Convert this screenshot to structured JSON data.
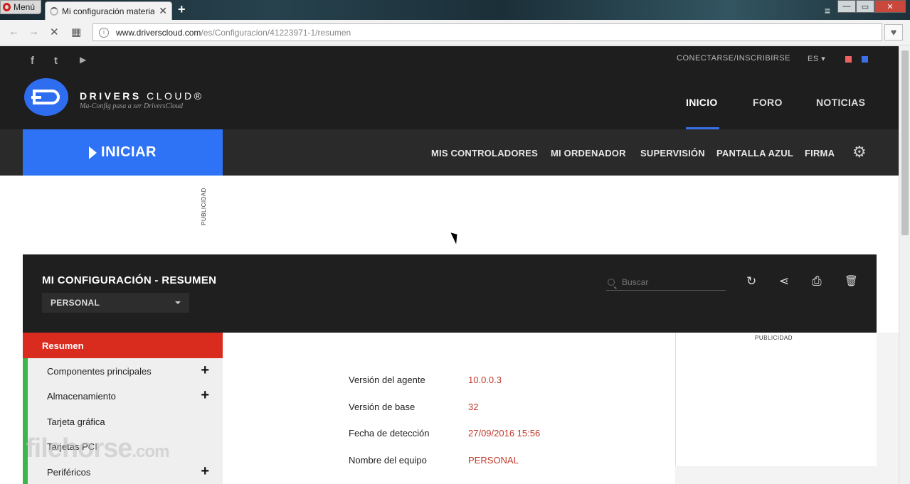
{
  "browser": {
    "menu_label": "Menú",
    "tab_title": "Mi configuración material",
    "tab_close": "✕",
    "new_tab": "+",
    "url_host": "www.driverscloud.com",
    "url_path": "/es/Configuracion/41223971-1/resumen",
    "back_icon": "←",
    "forward_icon": "→",
    "stop_icon": "✕",
    "speed_dial_icon": "▦",
    "bookmark_icon": "♥",
    "window_controls": {
      "minimize": "—",
      "maximize": "▭",
      "close": "✕"
    },
    "menu_lines": "≡"
  },
  "header": {
    "social": {
      "facebook": "f",
      "twitter": "t",
      "youtube": "▶"
    },
    "login_link": "CONECTARSE/INSCRIBIRSE",
    "language": "ES ▾",
    "flag_colors": [
      "#f06262",
      "#3b6fe8"
    ],
    "brand_bold": "DRIVERS",
    "brand_light": "CLOUD®",
    "tagline": "Ma-Config pasa a ser DriversCloud",
    "nav": [
      "INICIO",
      "FORO",
      "NOTICIAS"
    ],
    "accent_color": "#2e73f5"
  },
  "subnav": {
    "start_button": "INICIAR",
    "items": [
      "MIS CONTROLADORES",
      "MI ORDENADOR",
      "SUPERVISIÓN",
      "PANTALLA AZUL",
      "FIRMA"
    ],
    "settings_icon": "⚙"
  },
  "ad_label": "PUBLICIDAD",
  "config": {
    "title": "MI CONFIGURACIÓN - RESUMEN",
    "profile_select": "PERSONAL",
    "search_placeholder": "Buscar",
    "actions": {
      "refresh": "↻",
      "share": "⋖",
      "print": "⎙",
      "delete": "🗑"
    }
  },
  "sidebar": {
    "items": [
      {
        "label": "Resumen",
        "expandable": false
      },
      {
        "label": "Componentes principales",
        "expandable": true
      },
      {
        "label": "Almacenamiento",
        "expandable": true
      },
      {
        "label": "Tarjeta gráfica",
        "expandable": false
      },
      {
        "label": "Tarjetas PCI",
        "expandable": false
      },
      {
        "label": "Periféricos",
        "expandable": true
      }
    ],
    "plus": "+"
  },
  "summary": {
    "rows": [
      {
        "label": "Versión del agente",
        "value": "10.0.0.3"
      },
      {
        "label": "Versión de base",
        "value": "32"
      },
      {
        "label": "Fecha de detección",
        "value": "27/09/2016 15:56"
      },
      {
        "label": "Nombre del equipo",
        "value": "PERSONAL"
      }
    ]
  },
  "right_ad_label": "PUBLICIDAD",
  "watermark": {
    "main": "filehorse",
    "suffix": ".com"
  }
}
